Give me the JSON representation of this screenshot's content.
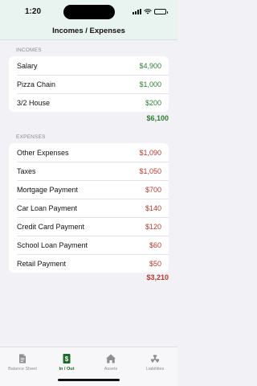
{
  "status_bar": {
    "time": "1:20"
  },
  "nav": {
    "title": "Incomes / Expenses"
  },
  "incomes": {
    "label": "INCOMES",
    "items": [
      {
        "name": "Salary",
        "amount": "$4,900"
      },
      {
        "name": "Pizza Chain",
        "amount": "$1,000"
      },
      {
        "name": "3/2 House",
        "amount": "$200"
      }
    ],
    "total": "$6,100"
  },
  "expenses": {
    "label": "EXPENSES",
    "items": [
      {
        "name": "Other Expenses",
        "amount": "$1,090"
      },
      {
        "name": "Taxes",
        "amount": "$1,050"
      },
      {
        "name": "Mortgage Payment",
        "amount": "$700"
      },
      {
        "name": "Car Loan Payment",
        "amount": "$140"
      },
      {
        "name": "Credit Card Payment",
        "amount": "$120"
      },
      {
        "name": "School Loan Payment",
        "amount": "$60"
      },
      {
        "name": "Retail Payment",
        "amount": "$50"
      }
    ],
    "total": "$3,210"
  },
  "tabbar": {
    "tabs": [
      {
        "label": "Balance Sheet",
        "icon": "document-icon",
        "active": false
      },
      {
        "label": "In / Out",
        "icon": "dollar-icon",
        "active": true
      },
      {
        "label": "Assets",
        "icon": "house-icon",
        "active": false
      },
      {
        "label": "Liabilities",
        "icon": "radiation-icon",
        "active": false
      }
    ]
  },
  "colors": {
    "income": "#2f7d32",
    "expense": "#b23b2e",
    "accent": "#1d6b2a",
    "header_bg": "#e9f3ef"
  }
}
